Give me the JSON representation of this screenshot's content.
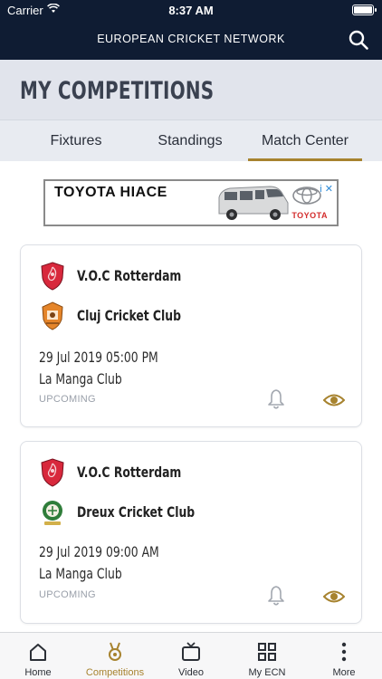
{
  "status_bar": {
    "carrier": "Carrier",
    "time": "8:37 AM"
  },
  "header": {
    "brand": "EUROPEAN CRICKET NETWORK",
    "search_icon": "search-icon"
  },
  "page": {
    "title": "MY COMPETITIONS"
  },
  "tabs": [
    {
      "label": "Fixtures",
      "active": false
    },
    {
      "label": "Standings",
      "active": false
    },
    {
      "label": "Match Center",
      "active": true
    }
  ],
  "ad": {
    "headline": "TOYOTA HIACE",
    "brand": "TOYOTA",
    "choices": "i ✕"
  },
  "matches": [
    {
      "team1": "V.O.C Rotterdam",
      "team2": "Cluj Cricket Club",
      "datetime": "29 Jul 2019 05:00 PM",
      "venue": "La Manga Club",
      "status": "UPCOMING"
    },
    {
      "team1": "V.O.C Rotterdam",
      "team2": "Dreux Cricket Club",
      "datetime": "29 Jul 2019 09:00 AM",
      "venue": "La Manga Club",
      "status": "UPCOMING"
    }
  ],
  "bottom_nav": [
    {
      "label": "Home",
      "icon": "home-icon",
      "active": false
    },
    {
      "label": "Competitions",
      "icon": "medal-icon",
      "active": true
    },
    {
      "label": "Video",
      "icon": "tv-icon",
      "active": false
    },
    {
      "label": "My ECN",
      "icon": "grid-icon",
      "active": false
    },
    {
      "label": "More",
      "icon": "more-vertical-icon",
      "active": false
    }
  ],
  "colors": {
    "navy": "#0f1c33",
    "gold": "#a7832f",
    "title_band": "#e1e4ec"
  }
}
